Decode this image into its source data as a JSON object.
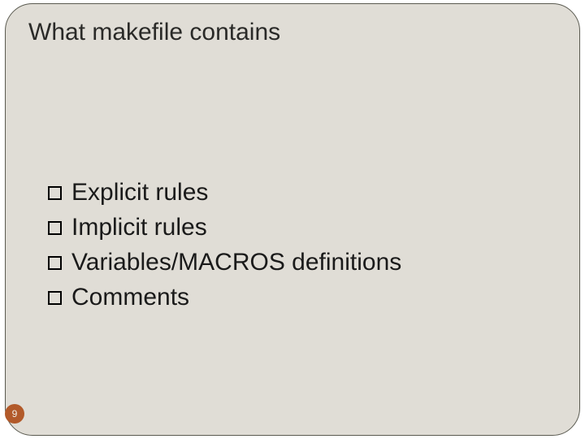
{
  "slide": {
    "title": "What makefile contains",
    "bullets": [
      "Explicit rules",
      "Implicit rules",
      "Variables/MACROS definitions",
      "Comments"
    ],
    "page_number": "9"
  }
}
